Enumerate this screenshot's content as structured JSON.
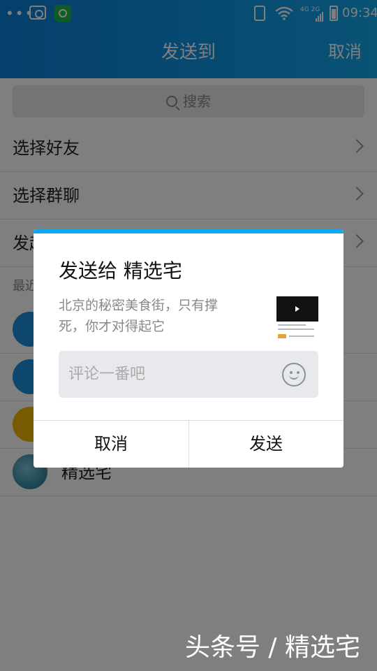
{
  "status_bar": {
    "time": "09:34",
    "network": "4G 2G"
  },
  "header": {
    "title": "发送到",
    "cancel_label": "取消"
  },
  "search": {
    "placeholder": "搜索"
  },
  "menu": {
    "items": [
      {
        "label": "选择好友"
      },
      {
        "label": "选择群聊"
      },
      {
        "label": "发起"
      }
    ]
  },
  "recent": {
    "label": "最近",
    "contacts": [
      {
        "name": "",
        "avatar_color": "#1a8fd8"
      },
      {
        "name": "",
        "avatar_color": "#1a8fd8"
      },
      {
        "name": "",
        "avatar_color": "#f0b400"
      },
      {
        "name": "精选宅",
        "avatar_color": "#3a8fa8"
      }
    ]
  },
  "dialog": {
    "title": "发送给 精选宅",
    "description": "北京的秘密美食街，只有撑死，你才对得起它",
    "comment_placeholder": "评论一番吧",
    "cancel_label": "取消",
    "send_label": "发送",
    "accent_color": "#12a6ea"
  },
  "watermark": "头条号 / 精选宅"
}
